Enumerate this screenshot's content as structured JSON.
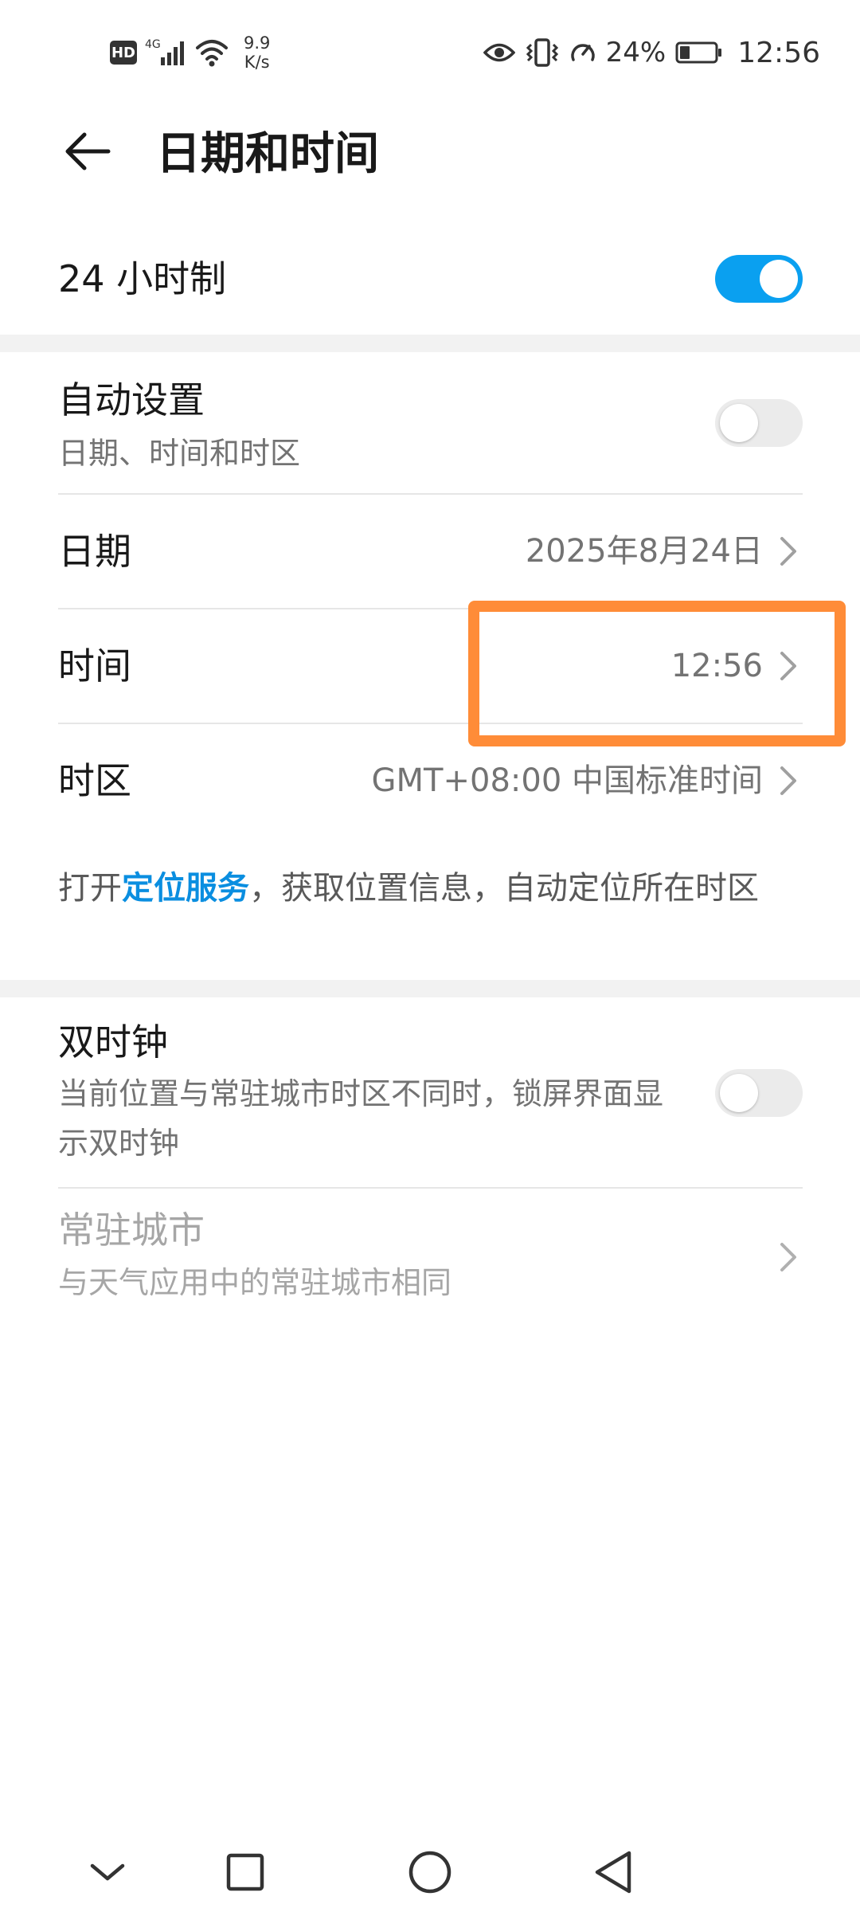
{
  "status_bar": {
    "hd": "HD",
    "signal_label": "4G",
    "net_speed_value": "9.9",
    "net_speed_unit": "K/s",
    "battery_percent": "24%",
    "time": "12:56"
  },
  "header": {
    "title": "日期和时间"
  },
  "settings": {
    "hour24": {
      "label": "24 小时制",
      "enabled": true
    },
    "auto_set": {
      "label": "自动设置",
      "sub": "日期、时间和时区",
      "enabled": false
    },
    "date": {
      "label": "日期",
      "value": "2025年8月24日"
    },
    "time": {
      "label": "时间",
      "value": "12:56"
    },
    "timezone": {
      "label": "时区",
      "value": "GMT+08:00 中国标准时间"
    },
    "note": {
      "prefix": "打开",
      "link": "定位服务",
      "suffix": "，获取位置信息，自动定位所在时区"
    },
    "dual_clock": {
      "label": "双时钟",
      "sub": "当前位置与常驻城市时区不同时，锁屏界面显示双时钟",
      "enabled": false
    },
    "home_city": {
      "label": "常驻城市",
      "sub": "与天气应用中的常驻城市相同"
    }
  },
  "colors": {
    "accent": "#0aa0f0",
    "link": "#0a8ee0",
    "highlight": "#ff8c38"
  }
}
